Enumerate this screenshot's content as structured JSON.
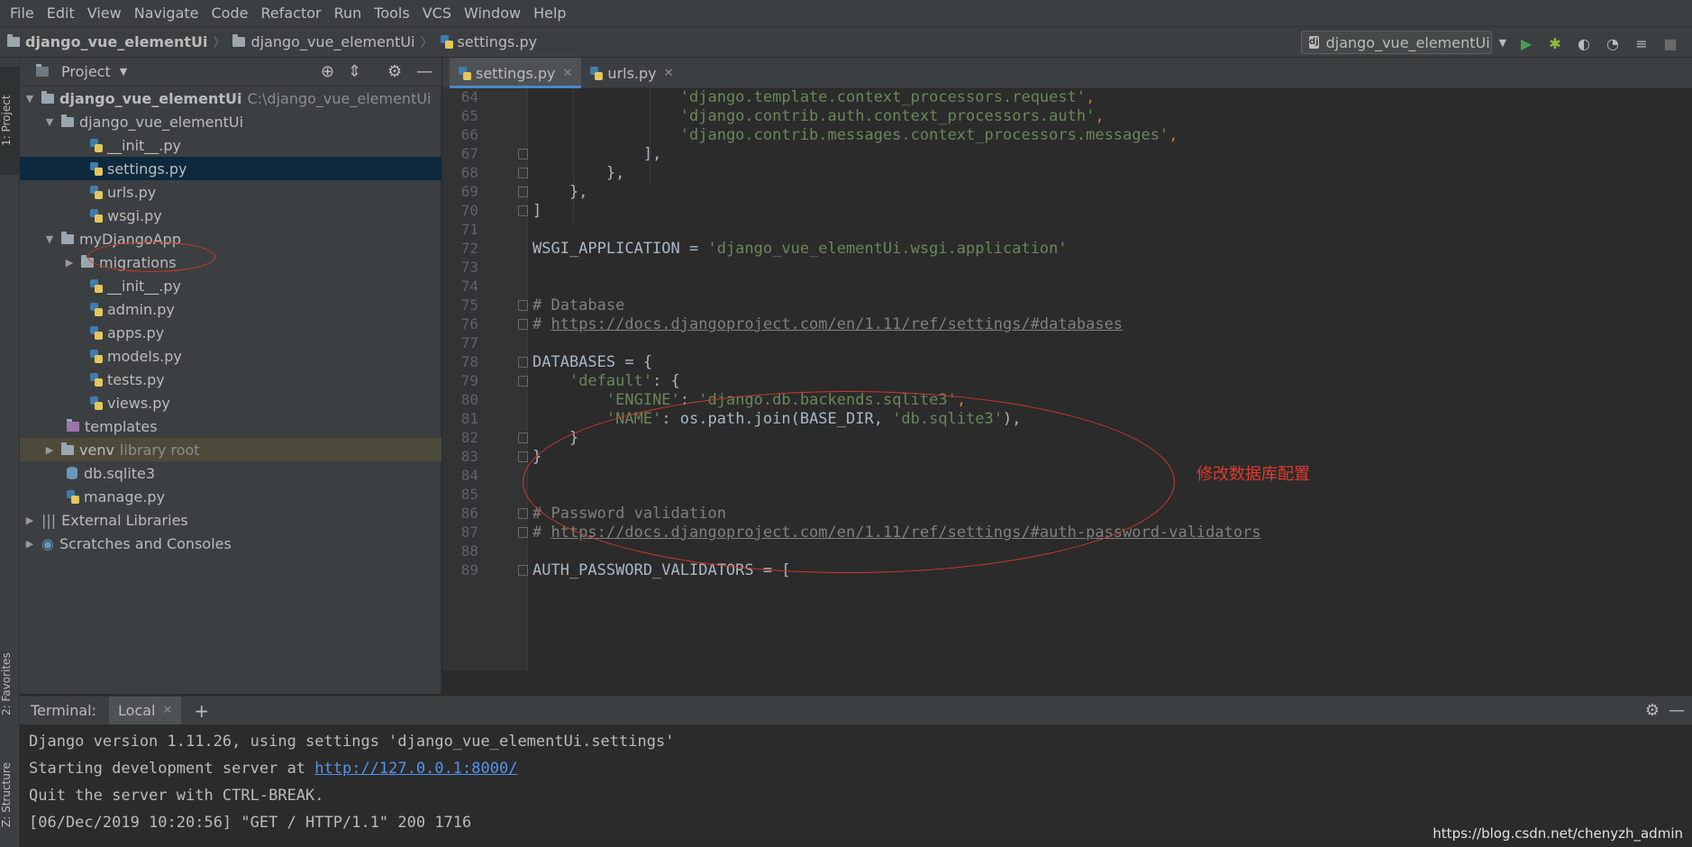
{
  "menu": [
    "File",
    "Edit",
    "View",
    "Navigate",
    "Code",
    "Refactor",
    "Run",
    "Tools",
    "VCS",
    "Window",
    "Help"
  ],
  "breadcrumb": [
    "django_vue_elementUi",
    "django_vue_elementUi",
    "settings.py"
  ],
  "run_config": "django_vue_elementUi",
  "left_stripe": {
    "project": "1: Project",
    "favorites": "2: Favorites",
    "structure": "Z: Structure"
  },
  "project_panel": {
    "title": "Project",
    "root": {
      "name": "django_vue_elementUi",
      "path": "C:\\django_vue_elementUi"
    },
    "items": [
      {
        "label": "django_vue_elementUi"
      },
      {
        "label": "__init__.py"
      },
      {
        "label": "settings.py"
      },
      {
        "label": "urls.py"
      },
      {
        "label": "wsgi.py"
      },
      {
        "label": "myDjangoApp"
      },
      {
        "label": "migrations"
      },
      {
        "label": "__init__.py"
      },
      {
        "label": "admin.py"
      },
      {
        "label": "apps.py"
      },
      {
        "label": "models.py"
      },
      {
        "label": "tests.py"
      },
      {
        "label": "views.py"
      },
      {
        "label": "templates"
      },
      {
        "label": "venv",
        "note": "library root"
      },
      {
        "label": "db.sqlite3"
      },
      {
        "label": "manage.py"
      },
      {
        "label": "External Libraries"
      },
      {
        "label": "Scratches and Consoles"
      }
    ]
  },
  "editor_tabs": [
    {
      "label": "settings.py",
      "active": true
    },
    {
      "label": "urls.py",
      "active": false
    }
  ],
  "code": {
    "line_numbers": [
      "64",
      "65",
      "66",
      "67",
      "68",
      "69",
      "70",
      "71",
      "72",
      "73",
      "74",
      "75",
      "76",
      "77",
      "78",
      "79",
      "80",
      "81",
      "82",
      "83",
      "84",
      "85",
      "86",
      "87",
      "88",
      "89"
    ],
    "l64": "'django.template.context_processors.request'",
    "l65": "'django.contrib.auth.context_processors.auth'",
    "l66": "'django.contrib.messages.context_processors.messages'",
    "l67": "],",
    "l68": "},",
    "l69": "},",
    "l70": "]",
    "l72a": "WSGI_APPLICATION = ",
    "l72b": "'django_vue_elementUi.wsgi.application'",
    "l75": "# Database",
    "l76a": "# ",
    "l76b": "https://docs.djangoproject.com/en/1.11/ref/settings/#databases",
    "l78": "DATABASES = {",
    "l79a": "'default'",
    "l79b": ": {",
    "l80a": "'ENGINE'",
    "l80b": ": ",
    "l80c": "'django.db.backends.sqlite3'",
    "l81a": "'NAME'",
    "l81b": ": os.path.join(BASE_DIR, ",
    "l81c": "'db.sqlite3'",
    "l81d": "),",
    "l82": "}",
    "l83": "}",
    "l86": "# Password validation",
    "l87a": "# ",
    "l87b": "https://docs.djangoproject.com/en/1.11/ref/settings/#auth-password-validators",
    "l89": "AUTH_PASSWORD_VALIDATORS = ["
  },
  "annotation": "修改数据库配置",
  "terminal": {
    "label": "Terminal:",
    "tab": "Local",
    "lines": {
      "l1": "Django version 1.11.26, using settings 'django_vue_elementUi.settings'",
      "l2a": "Starting development server at ",
      "l2b": "http://127.0.0.1:8000/",
      "l3": "Quit the server with CTRL-BREAK.",
      "l4": "[06/Dec/2019 10:20:56] \"GET / HTTP/1.1\" 200 1716"
    }
  },
  "watermark": "https://blog.csdn.net/chenyzh_admin",
  "colors": {
    "accent": "#4a88c7",
    "annotation": "#d0392b",
    "string": "#6a8759",
    "keyword": "#cc7832",
    "selection": "#0d293e"
  }
}
